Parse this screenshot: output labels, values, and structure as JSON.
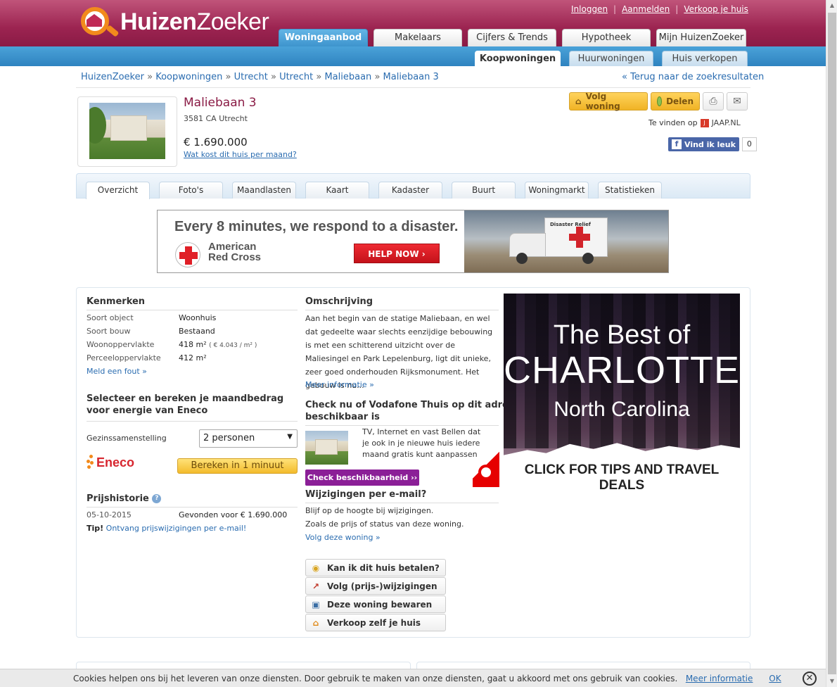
{
  "header": {
    "logo_bold": "Huizen",
    "logo_light": "Zoeker",
    "links": [
      "Inloggen",
      "Aanmelden",
      "Verkoop je huis"
    ],
    "main_tabs": [
      "Woningaanbod",
      "Makelaars",
      "Cijfers & Trends",
      "Hypotheek",
      "Mijn HuizenZoeker"
    ],
    "sub_tabs": [
      "Koopwoningen",
      "Huurwoningen",
      "Huis verkopen"
    ]
  },
  "breadcrumb": [
    "HuizenZoeker",
    "Koopwoningen",
    "Utrecht",
    "Utrecht",
    "Maliebaan",
    "Maliebaan 3"
  ],
  "breadcrumb_sep": "»",
  "back_link": "« Terug naar de zoekresultaten",
  "listing": {
    "title": "Maliebaan 3",
    "address": "3581 CA Utrecht",
    "price": "€ 1.690.000",
    "per_month_link": "Wat kost dit huis per maand?"
  },
  "actions": {
    "follow": "Volg woning",
    "share": "Delen",
    "found_on_label": "Te vinden op",
    "found_on_site": "JAAP.NL",
    "fb_like": "Vind ik leuk",
    "fb_count": "0"
  },
  "page_tabs": [
    "Overzicht",
    "Foto's",
    "Maandlasten",
    "Kaart",
    "Kadaster",
    "Buurt",
    "Woningmarkt",
    "Statistieken"
  ],
  "banner_ad": {
    "headline": "Every 8 minutes, we respond to a disaster.",
    "org_line1": "American",
    "org_line2": "Red Cross",
    "button": "HELP NOW  ›",
    "truck_label": "Disaster Relief"
  },
  "kenmerken": {
    "title": "Kenmerken",
    "rows": [
      {
        "label": "Soort object",
        "value": "Woonhuis"
      },
      {
        "label": "Soort bouw",
        "value": "Bestaand"
      },
      {
        "label": "Woonoppervlakte",
        "value": "418 m²",
        "extra": "( € 4.043 / m² )"
      },
      {
        "label": "Perceeloppervlakte",
        "value": "412 m²"
      }
    ],
    "report_link": "Meld een fout »"
  },
  "energie": {
    "title_line1": "Selecteer en bereken je maandbedrag",
    "title_line2": "voor energie van Eneco",
    "household_label": "Gezinssamenstelling",
    "household_value": "2 personen",
    "brand": "Eneco",
    "calc_button": "Bereken in 1 minuut"
  },
  "prijshistorie": {
    "title": "Prijshistorie",
    "date": "05-10-2015",
    "event": "Gevonden voor € 1.690.000",
    "tip_label": "Tip!",
    "tip_link": "Ontvang prijswijzigingen per e-mail!"
  },
  "omschrijving": {
    "title": "Omschrijving",
    "text": "Aan het begin van de statige Maliebaan, en wel dat gedeelte waar slechts eenzijdige bebouwing is met een schitterend uitzicht over de Maliesingel en Park Lepelenburg, ligt dit unieke, zeer goed onderhouden Rijksmonument. Het gebouw is nu...",
    "more_link": "Meer informatie »"
  },
  "vodafone": {
    "title_line1": "Check nu of Vodafone Thuis op dit adres",
    "title_line2": "beschikbaar is",
    "text": "TV, Internet en vast Bellen dat je ook in je nieuwe huis iedere maand gratis kunt aanpassen",
    "button": "Check beschikbaarheid ››"
  },
  "email_alerts": {
    "title": "Wijzigingen per e-mail?",
    "line1": "Blijf op de hoogte bij wijzigingen.",
    "line2": "Zoals de prijs of status van deze woning.",
    "link": "Volg deze woning »"
  },
  "action_buttons": [
    "Kan ik dit huis betalen?",
    "Volg (prijs-)wijzigingen",
    "Deze woning bewaren",
    "Verkoop zelf je huis"
  ],
  "side_ad": {
    "line1": "The Best of",
    "line2": "CHARLOTTE",
    "line3": "North Carolina",
    "cta": "CLICK FOR TIPS AND TRAVEL DEALS"
  },
  "cookie_bar": {
    "text": "Cookies helpen ons bij het leveren van onze diensten. Door gebruik te maken van onze diensten, gaat u akkoord met ons gebruik van cookies.",
    "more": "Meer informatie",
    "ok": "OK"
  }
}
